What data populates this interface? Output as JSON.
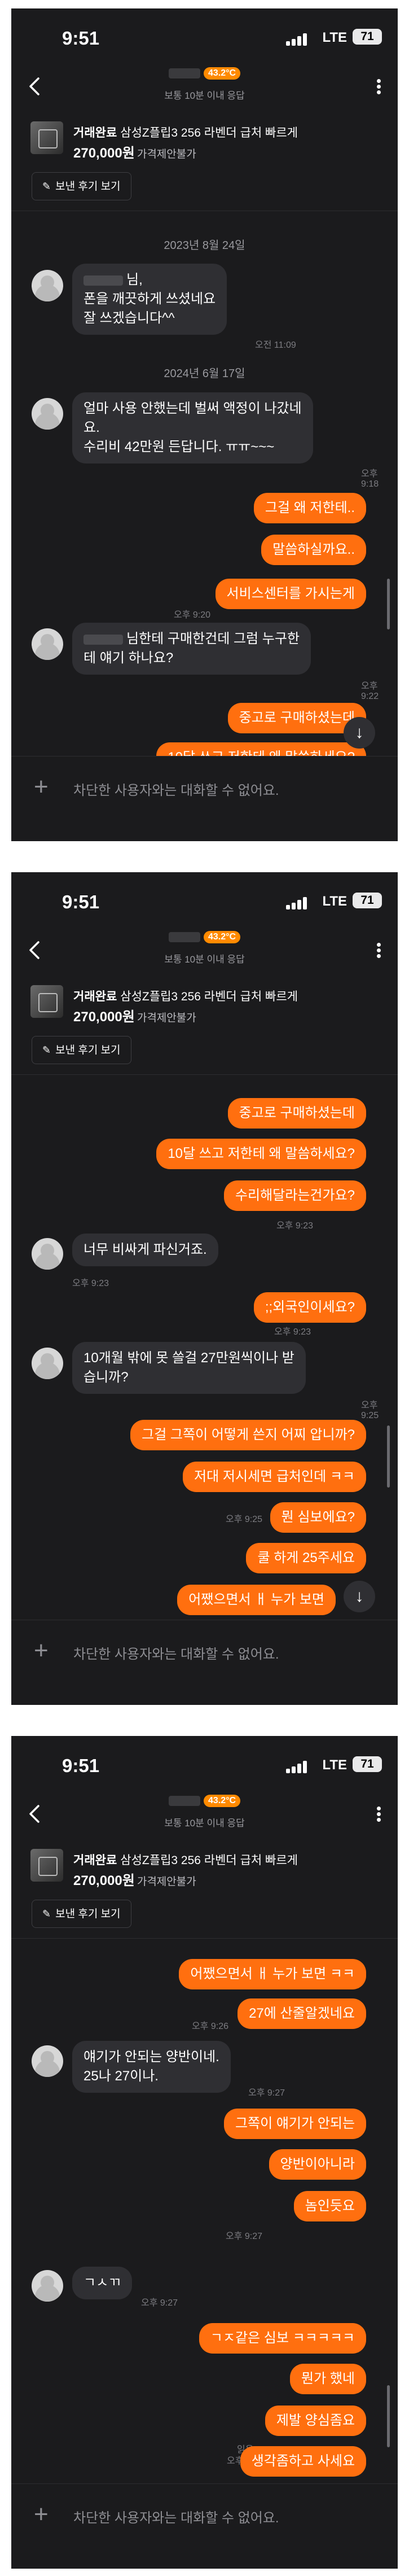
{
  "screens": [
    {
      "time": "9:51",
      "network": "LTE",
      "battery": "71",
      "temp_badge": "43.2°C",
      "response_time": "보통 10분 이내 응답",
      "product_status": "거래완료",
      "product_title": "삼성Z플립3 256 라벤더 급처 빠르게",
      "product_price": "270,000원",
      "price_note": "가격제안불가",
      "review_button": "보낸 후기 보기",
      "composer_placeholder": "차단한 사용자와는 대화할 수 없어요."
    },
    {
      "time": "9:51",
      "network": "LTE",
      "battery": "71",
      "temp_badge": "43.2°C",
      "response_time": "보통 10분 이내 응답",
      "product_status": "거래완료",
      "product_title": "삼성Z플립3 256 라벤더 급처 빠르게",
      "product_price": "270,000원",
      "price_note": "가격제안불가",
      "review_button": "보낸 후기 보기",
      "composer_placeholder": "차단한 사용자와는 대화할 수 없어요."
    },
    {
      "time": "9:51",
      "network": "LTE",
      "battery": "71",
      "temp_badge": "43.2°C",
      "response_time": "보통 10분 이내 응답",
      "product_status": "거래완료",
      "product_title": "삼성Z플립3 256 라벤더 급처 빠르게",
      "product_price": "270,000원",
      "price_note": "가격제안불가",
      "review_button": "보낸 후기 보기",
      "composer_placeholder": "차단한 사용자와는 대화할 수 없어요."
    }
  ],
  "chat1": {
    "date1": "2023년 8월 24일",
    "m1": "님,\n폰을 깨끗하게 쓰셨네요\n잘 쓰겠습니다^^",
    "t1": "오전 11:09",
    "date2": "2024년 6월 17일",
    "m2": "얼마 사용 안했는데 벌써 액정이 나갔네\n요.\n수리비 42만원 든답니다. ㅠㅠ~~~",
    "t2": "오후 9:18",
    "o1": "그걸 왜 저한테..",
    "o2": "말씀하실까요..",
    "o3": "서비스센터를 가시는게",
    "t3": "오후 9:20",
    "m3": "님한테 구매한건데 그럼 누구한\n테 얘기 하나요?",
    "t4": "오후 9:22",
    "o4": "중고로 구매하셨는데",
    "o5": "10달 쓰고 저한테 왜 말씀하세요?"
  },
  "chat2": {
    "o1": "중고로 구매하셨는데",
    "o2": "10달 쓰고 저한테 왜 말씀하세요?",
    "o3": "수리해달라는건가요?",
    "t1": "오후 9:23",
    "m1": "너무 비싸게 파신거죠.",
    "t2": "오후 9:23",
    "o4": ";;외국인이세요?",
    "t3": "오후 9:23",
    "m2": "10개월 밖에 못 쓸걸 27만원씩이나  받\n습니까?",
    "t4": "오후 9:25",
    "o5": "그걸 그쪽이 어떻게 쓴지 어찌 압니까?",
    "o6": "저대 저시세면 급처인데 ㅋㅋ",
    "o7": "뭔 심보에요?",
    "t5": "오후 9:25",
    "o8": "쿨 하게 25주세요",
    "o9": "어쨌으면서 ㅐ 누가 보면"
  },
  "chat3": {
    "o1": "어쨌으면서 ㅐ 누가 보면 ㅋㅋ",
    "t1": "오후 9:26",
    "o2": "27에 산줄알겠네요",
    "m1": "얘기가 안되는 양반이네.\n25나 27이나.",
    "t2": "오후 9:27",
    "o3": "그쪽이 얘기가 안되는",
    "o4": "양반이아니라",
    "o5": "놈인듯요",
    "t3": "오후 9:27",
    "m2": "ㄱㅅㄲ",
    "t4": "오후 9:27",
    "o6": "ㄱㅈ같은 심보 ㅋㅋㅋㅋㅋ",
    "o7": "뭔가 했네",
    "o8": "제발 양심좀요",
    "read": "읽음",
    "t5": "오후 9:28",
    "o9": "생각좀하고 사세요"
  }
}
